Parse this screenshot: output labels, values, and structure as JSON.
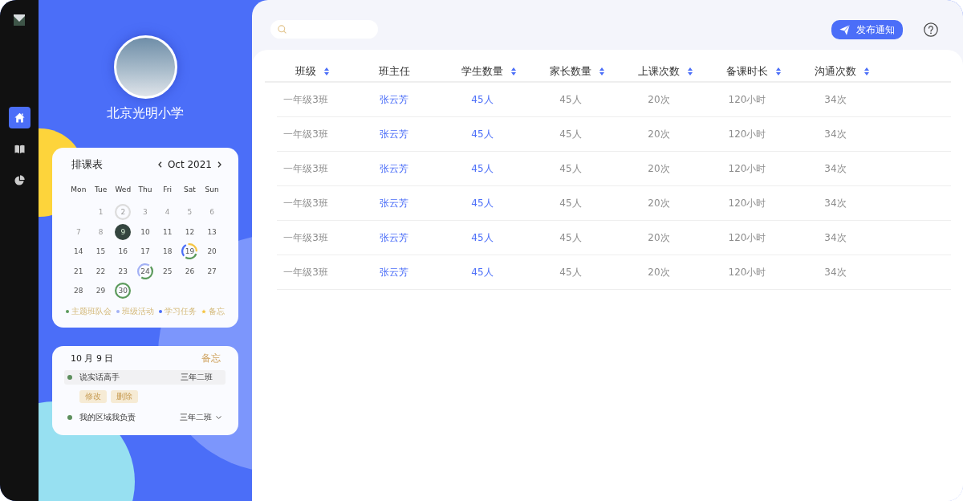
{
  "rail": {
    "nav": [
      {
        "selected": true
      },
      {
        "selected": false
      },
      {
        "selected": false
      }
    ]
  },
  "profile": {
    "school": "北京光明小学"
  },
  "schedule": {
    "title": "排课表",
    "month": "Oct 2021",
    "weekdays": [
      "Mon",
      "Tue",
      "Wed",
      "Thu",
      "Fri",
      "Sat",
      "Sun"
    ],
    "weeks": [
      {
        "kind": "leading",
        "days": [
          {
            "label": "1",
            "muted": true,
            "selected": false
          },
          {
            "label": "2",
            "muted": true,
            "selected": false,
            "events": [
              {
                "color": "#dcdcdc"
              }
            ]
          },
          {
            "label": "3",
            "muted": true,
            "selected": false
          },
          {
            "label": "4",
            "muted": true,
            "selected": false
          },
          {
            "label": "5",
            "muted": true,
            "selected": false
          },
          {
            "label": "6",
            "muted": true,
            "selected": false
          }
        ]
      },
      {
        "kind": "full",
        "days": [
          {
            "label": "7",
            "muted": true,
            "selected": false
          },
          {
            "label": "8",
            "muted": true,
            "selected": false
          },
          {
            "label": "9",
            "muted": false,
            "selected": true
          },
          {
            "label": "10",
            "muted": false,
            "selected": false
          },
          {
            "label": "11",
            "muted": false,
            "selected": false
          },
          {
            "label": "12",
            "muted": false,
            "selected": false
          },
          {
            "label": "13",
            "muted": false,
            "selected": false
          }
        ]
      },
      {
        "kind": "full",
        "days": [
          {
            "label": "14",
            "muted": false,
            "selected": false
          },
          {
            "label": "15",
            "muted": false,
            "selected": false
          },
          {
            "label": "16",
            "muted": false,
            "selected": false
          },
          {
            "label": "17",
            "muted": false,
            "selected": false
          },
          {
            "label": "18",
            "muted": false,
            "selected": false
          },
          {
            "label": "19",
            "muted": false,
            "selected": false,
            "events": [
              {
                "color": "#4b6ef8"
              },
              {
                "color": "#f5c542"
              },
              {
                "color": "#5b9a5b"
              }
            ]
          },
          {
            "label": "20",
            "muted": false,
            "selected": false
          }
        ]
      },
      {
        "kind": "full",
        "days": [
          {
            "label": "21",
            "muted": false,
            "selected": false
          },
          {
            "label": "22",
            "muted": false,
            "selected": false
          },
          {
            "label": "23",
            "muted": false,
            "selected": false
          },
          {
            "label": "24",
            "muted": false,
            "selected": false,
            "events": [
              {
                "color": "#a3b1f5"
              },
              {
                "color": "#5b9a5b"
              }
            ]
          },
          {
            "label": "25",
            "muted": false,
            "selected": false
          },
          {
            "label": "26",
            "muted": false,
            "selected": false
          },
          {
            "label": "27",
            "muted": false,
            "selected": false
          }
        ]
      },
      {
        "kind": "trailing",
        "days": [
          {
            "label": "28",
            "muted": false,
            "selected": false
          },
          {
            "label": "29",
            "muted": false,
            "selected": false
          },
          {
            "label": "30",
            "muted": false,
            "selected": false,
            "events": [
              {
                "color": "#5b9a5b"
              }
            ]
          }
        ]
      }
    ],
    "legend": [
      {
        "label": "主题班队会",
        "color": "#5b9a5b",
        "kind": "dot"
      },
      {
        "label": "班级活动",
        "color": "#a3b1f5",
        "kind": "dot"
      },
      {
        "label": "学习任务",
        "color": "#4b6ef8",
        "kind": "dot"
      },
      {
        "label": "备忘",
        "color": "#f5c542",
        "kind": "star"
      }
    ]
  },
  "agenda": {
    "date": "10 月 9 日",
    "memo": "备忘",
    "items": [
      {
        "title": "说实话高手",
        "class": "三年二班",
        "color": "#5d8f5d",
        "expanded": true,
        "actions": [
          "修改",
          "删除"
        ]
      },
      {
        "title": "我的区域我负责",
        "class": "三年二班",
        "color": "#5d8f5d",
        "expanded": false
      }
    ]
  },
  "toolbar": {
    "publish": "发布通知"
  },
  "table": {
    "columns": [
      {
        "label": "班级",
        "sortable": true,
        "kind": "text"
      },
      {
        "label": "班主任",
        "sortable": false,
        "kind": "link"
      },
      {
        "label": "学生数量",
        "sortable": true,
        "kind": "link"
      },
      {
        "label": "家长数量",
        "sortable": true,
        "kind": "text"
      },
      {
        "label": "上课次数",
        "sortable": true,
        "kind": "text"
      },
      {
        "label": "备课时长",
        "sortable": true,
        "kind": "text"
      },
      {
        "label": "沟通次数",
        "sortable": true,
        "kind": "text"
      }
    ],
    "rows": [
      [
        "一年级3班",
        "张云芳",
        "45人",
        "45人",
        "20次",
        "120小时",
        "34次"
      ],
      [
        "一年级3班",
        "张云芳",
        "45人",
        "45人",
        "20次",
        "120小时",
        "34次"
      ],
      [
        "一年级3班",
        "张云芳",
        "45人",
        "45人",
        "20次",
        "120小时",
        "34次"
      ],
      [
        "一年级3班",
        "张云芳",
        "45人",
        "45人",
        "20次",
        "120小时",
        "34次"
      ],
      [
        "一年级3班",
        "张云芳",
        "45人",
        "45人",
        "20次",
        "120小时",
        "34次"
      ],
      [
        "一年级3班",
        "张云芳",
        "45人",
        "45人",
        "20次",
        "120小时",
        "34次"
      ]
    ]
  }
}
